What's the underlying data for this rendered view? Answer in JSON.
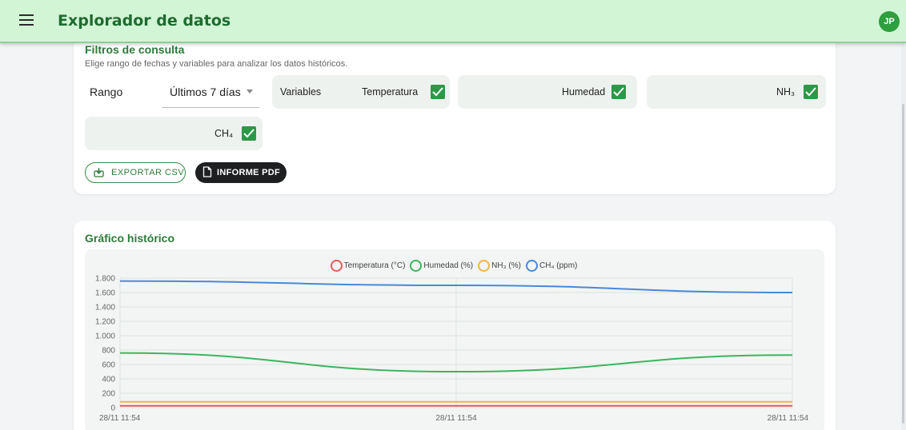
{
  "appbar": {
    "title": "Explorador de datos",
    "avatar": "JP",
    "menu_icon": "hamburger-menu-icon"
  },
  "filters": {
    "title": "Filtros de consulta",
    "subtitle": "Elige rango de fechas y variables para analizar los datos históricos.",
    "rango_label": "Rango",
    "rango_value": "Últimos 7 días",
    "variables_label": "Variables",
    "variables": [
      {
        "label": "Temperatura",
        "checked": true
      },
      {
        "label": "Humedad",
        "checked": true
      },
      {
        "label": "NH₃",
        "checked": true
      },
      {
        "label": "CH₄",
        "checked": true
      }
    ],
    "export_csv": "EXPORTAR CSV",
    "informe_pdf": "INFORME PDF"
  },
  "chart_section": {
    "title": "Gráfico histórico"
  },
  "chart_data": {
    "type": "line",
    "x": [
      "28/11 11:54",
      "28/11 11:54",
      "28/11 11:54"
    ],
    "ylim": [
      0,
      1800
    ],
    "yticks": [
      "0",
      "200",
      "400",
      "600",
      "800",
      "1.000",
      "1.200",
      "1.400",
      "1.600",
      "1.800"
    ],
    "grid": true,
    "legend_position": "top-center",
    "series": [
      {
        "name": "Temperatura (°C)",
        "color": "#e05a5a",
        "values": [
          25,
          25,
          25
        ]
      },
      {
        "name": "Humedad (%)",
        "color": "#3cb55e",
        "values": [
          760,
          500,
          730
        ]
      },
      {
        "name": "NH₃ (%)",
        "color": "#f0b44a",
        "values": [
          80,
          80,
          80
        ]
      },
      {
        "name": "CH₄ (ppm)",
        "color": "#4a88d8",
        "values": [
          1760,
          1700,
          1600
        ]
      }
    ]
  }
}
